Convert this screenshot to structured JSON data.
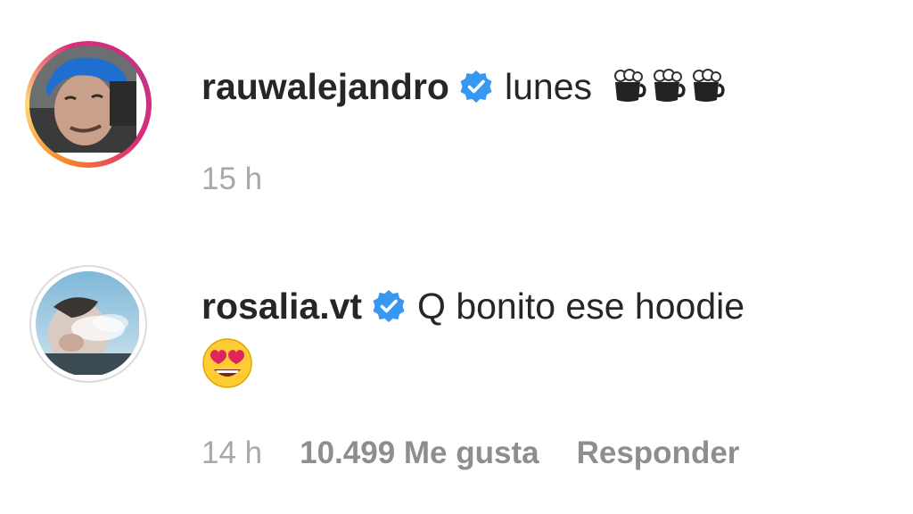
{
  "comments": [
    {
      "username": "rauwalejandro",
      "text": "lunes",
      "emoji_text": "☕☕☕",
      "time": "15 h"
    },
    {
      "username": "rosalia.vt",
      "text": "Q bonito ese hoodie",
      "emoji_text": "😍",
      "time": "14 h",
      "likes": "10.499 Me gusta",
      "reply_label": "Responder"
    }
  ],
  "colors": {
    "verified": "#3897f0",
    "text": "#262626",
    "meta": "#8e8e8e"
  }
}
